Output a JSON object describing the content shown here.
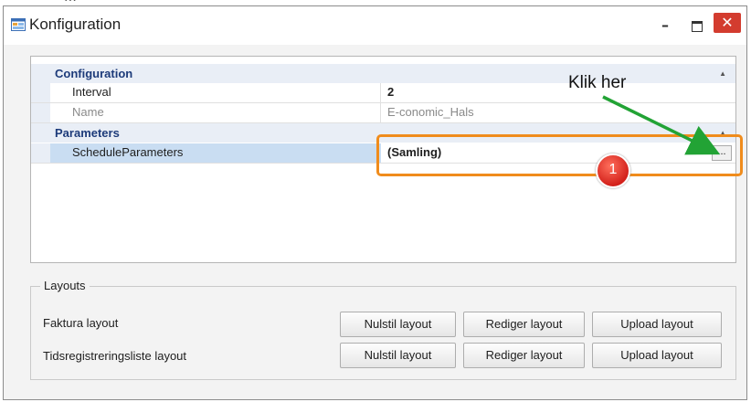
{
  "window": {
    "title": "Konfiguration",
    "minimize_glyph": "–",
    "close_glyph": "✕"
  },
  "property_grid": {
    "categories": [
      {
        "label": "Configuration",
        "rows": [
          {
            "name": "Interval",
            "value": "2"
          },
          {
            "name": "Name",
            "value": "E-conomic_Hals"
          }
        ]
      },
      {
        "label": "Parameters",
        "rows": [
          {
            "name": "ScheduleParameters",
            "value": "(Samling)",
            "ellipsis": "..."
          }
        ]
      }
    ]
  },
  "annotation": {
    "text": "Klik her",
    "badge": "1",
    "highlight_color": "#f08c1c",
    "arrow_color": "#22a335"
  },
  "layouts": {
    "title": "Layouts",
    "rows": [
      {
        "label": "Faktura layout",
        "reset": "Nulstil layout",
        "edit": "Rediger layout",
        "upload": "Upload layout"
      },
      {
        "label": "Tidsregistreringsliste layout",
        "reset": "Nulstil layout",
        "edit": "Rediger layout",
        "upload": "Upload layout"
      }
    ]
  },
  "icons": {
    "app": "form-window-icon",
    "collapse": "collapse-arrow-icon"
  }
}
